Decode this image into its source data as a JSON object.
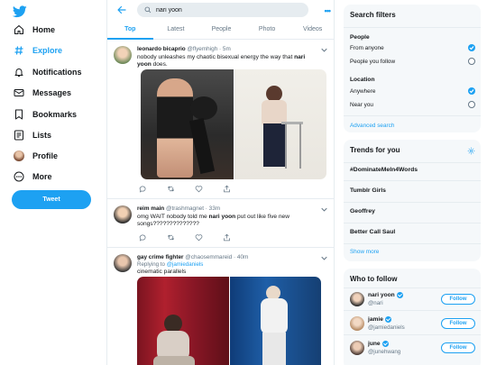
{
  "nav": {
    "items": [
      {
        "label": "Home",
        "icon": "home-icon"
      },
      {
        "label": "Explore",
        "icon": "hashtag-icon",
        "active": true
      },
      {
        "label": "Notifications",
        "icon": "bell-icon"
      },
      {
        "label": "Messages",
        "icon": "envelope-icon"
      },
      {
        "label": "Bookmarks",
        "icon": "bookmark-icon"
      },
      {
        "label": "Lists",
        "icon": "list-icon"
      },
      {
        "label": "Profile",
        "icon": "avatar"
      },
      {
        "label": "More",
        "icon": "more-circle-icon"
      }
    ],
    "tweet_button": "Tweet"
  },
  "search": {
    "value": "nari yoon"
  },
  "tabs": [
    "Top",
    "Latest",
    "People",
    "Photo",
    "Videos"
  ],
  "tweets": [
    {
      "name": "leonardo bicaprio",
      "handle": "@flyemhigh",
      "time": "· 5m",
      "text_before": "nobody unleashes my chaotic bisexual energy the way that ",
      "text_bold": "nari yoon",
      "text_after": " does."
    },
    {
      "name": "reim main",
      "handle": "@trashmagnet",
      "time": "· 33m",
      "text_before": "omg WAIT nobody told me ",
      "text_bold": "nari yoon",
      "text_after": " put out like five new songs??????????????"
    },
    {
      "name": "gay crime fighter",
      "handle": "@chaosemmareid",
      "time": "· 40m",
      "reply_prefix": "Replying to ",
      "reply_to": "@jamiedaniels",
      "text": "cinematic parallels"
    }
  ],
  "filters": {
    "title": "Search filters",
    "people_label": "People",
    "people_options": [
      "From anyone",
      "People you follow"
    ],
    "location_label": "Location",
    "location_options": [
      "Anywhere",
      "Near you"
    ],
    "advanced": "Advanced search"
  },
  "trends": {
    "title": "Trends for you",
    "items": [
      "#DominateMeIn4Words",
      "Tumblr Girls",
      "Geoffrey",
      "Better Call Saul"
    ],
    "show_more": "Show more"
  },
  "who_to_follow": {
    "title": "Who to follow",
    "follow_label": "Follow",
    "accounts": [
      {
        "name": "nari yoon",
        "handle": "@nari"
      },
      {
        "name": "jamie",
        "handle": "@jamiedaniels"
      },
      {
        "name": "june",
        "handle": "@junehwang"
      }
    ]
  },
  "colors": {
    "accent": "#1da1f2",
    "text": "#14171a",
    "muted": "#657786",
    "border": "#e6ecf0",
    "panel_bg": "#f5f8fa"
  }
}
